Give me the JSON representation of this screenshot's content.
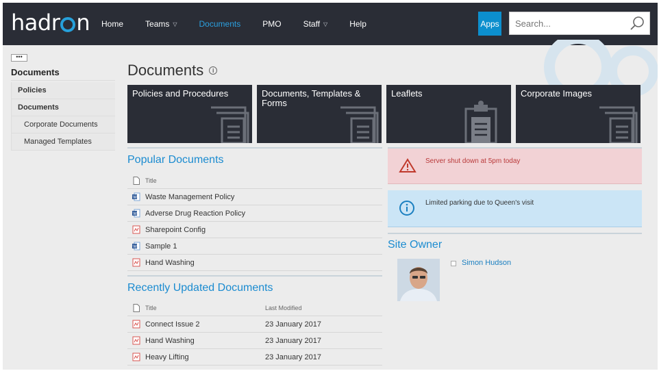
{
  "brand": {
    "logo_text_left": "hadr",
    "logo_text_right": "n"
  },
  "nav": {
    "items": [
      {
        "label": "Home",
        "active": false,
        "dropdown": false
      },
      {
        "label": "Teams",
        "active": false,
        "dropdown": true
      },
      {
        "label": "Documents",
        "active": true,
        "dropdown": false
      },
      {
        "label": "PMO",
        "active": false,
        "dropdown": false
      },
      {
        "label": "Staff",
        "active": false,
        "dropdown": true
      },
      {
        "label": "Help",
        "active": false,
        "dropdown": false
      }
    ],
    "apps_label": "Apps",
    "search_placeholder": "Search..."
  },
  "sidebar": {
    "ellipsis": "•••",
    "title": "Documents",
    "items": [
      {
        "label": "Policies"
      },
      {
        "label": "Documents"
      },
      {
        "label": "Corporate Documents"
      },
      {
        "label": "Managed Templates"
      }
    ]
  },
  "page": {
    "title": "Documents",
    "info_icon": "i"
  },
  "tiles": [
    {
      "label": "Policies and Procedures",
      "icon": "document-stack-icon"
    },
    {
      "label": "Documents, Templates & Forms",
      "icon": "document-stack-icon"
    },
    {
      "label": "Leaflets",
      "icon": "clipboard-icon"
    },
    {
      "label": "Corporate Images",
      "icon": "document-stack-icon"
    }
  ],
  "popular": {
    "heading": "Popular Documents",
    "col_title": "Title",
    "rows": [
      {
        "title": "Waste Management Policy",
        "type": "word"
      },
      {
        "title": "Adverse Drug Reaction Policy",
        "type": "word"
      },
      {
        "title": "Sharepoint Config",
        "type": "pdf"
      },
      {
        "title": "Sample 1",
        "type": "word"
      },
      {
        "title": "Hand Washing",
        "type": "pdf"
      }
    ]
  },
  "recent": {
    "heading": "Recently Updated Documents",
    "col_title": "Title",
    "col_modified": "Last Modified",
    "rows": [
      {
        "title": "Connect Issue 2",
        "modified": "23 January 2017",
        "type": "pdf"
      },
      {
        "title": "Hand Washing",
        "modified": "23 January 2017",
        "type": "pdf"
      },
      {
        "title": "Heavy Lifting",
        "modified": "23 January 2017",
        "type": "pdf"
      }
    ]
  },
  "alerts": {
    "warning": "Server shut down at 5pm today",
    "info": "Limited parking due to Queen's visit"
  },
  "site_owner": {
    "heading": "Site Owner",
    "name": "Simon Hudson"
  },
  "colors": {
    "topbar": "#2a2d36",
    "accent": "#1a8bd0",
    "apps": "#0c8fce",
    "warning_bg": "#f2d2d5",
    "info_bg": "#cbe5f6"
  }
}
